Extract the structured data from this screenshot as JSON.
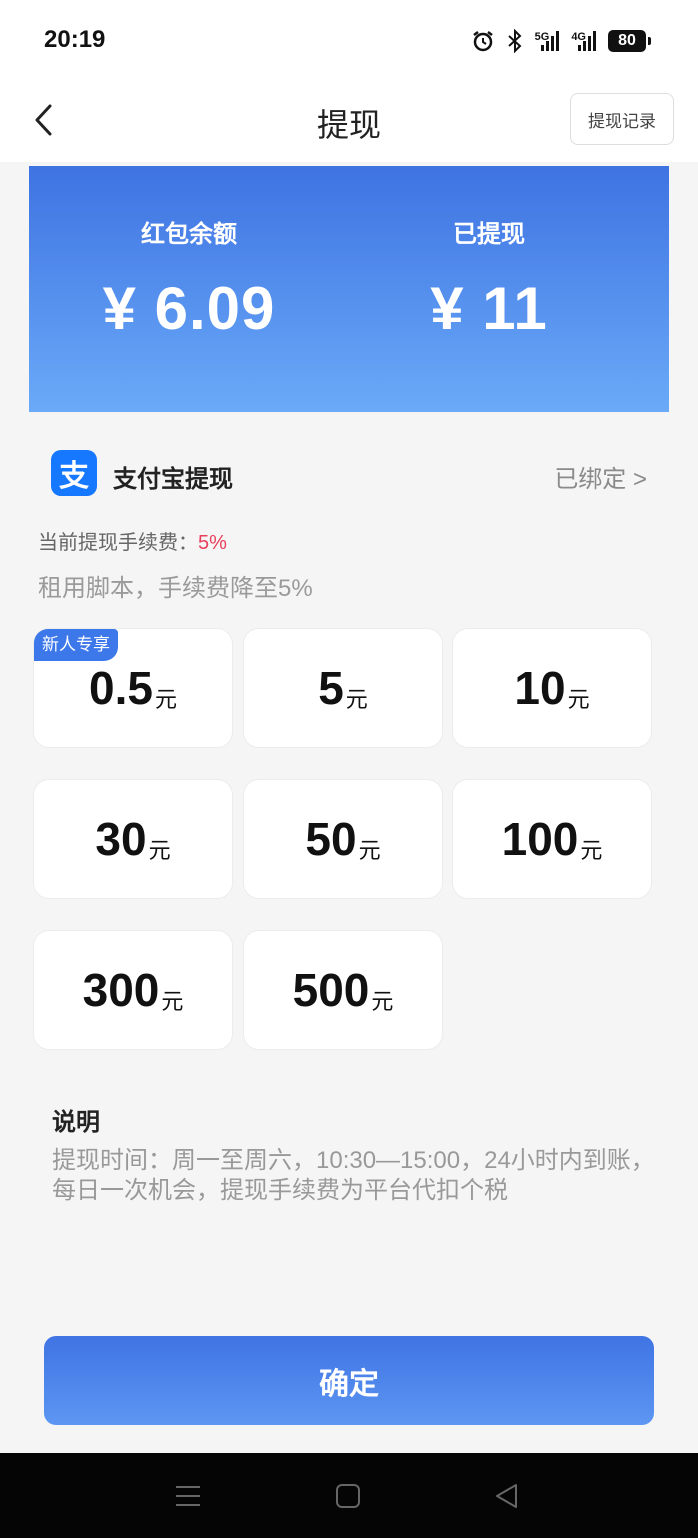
{
  "status_bar": {
    "time": "20:19",
    "network_5g": "5G",
    "network_4g": "4G",
    "battery": "80"
  },
  "nav": {
    "title": "提现",
    "record_button": "提现记录"
  },
  "balance": {
    "left_label": "红包余额",
    "left_value": "¥ 6.09",
    "right_label": "已提现",
    "right_value": "¥ 11"
  },
  "payment": {
    "icon_char": "支",
    "title": "支付宝提现",
    "status": "已绑定 >"
  },
  "fee": {
    "label": "当前提现手续费：",
    "rate": "5%",
    "tip": "租用脚本，手续费降至5%"
  },
  "amounts": [
    {
      "value": "0.5",
      "unit": "元",
      "badge": "新人专享"
    },
    {
      "value": "5",
      "unit": "元"
    },
    {
      "value": "10",
      "unit": "元"
    },
    {
      "value": "30",
      "unit": "元"
    },
    {
      "value": "50",
      "unit": "元"
    },
    {
      "value": "100",
      "unit": "元"
    },
    {
      "value": "300",
      "unit": "元"
    },
    {
      "value": "500",
      "unit": "元"
    }
  ],
  "description": {
    "title": "说明",
    "text": "提现时间：周一至周六，10:30—15:00，24小时内到账，每日一次机会，提现手续费为平台代扣个税"
  },
  "confirm_button": "确定",
  "colors": {
    "primary": "#3e73e2",
    "fee_rate": "#e8405b",
    "alipay": "#1677ff"
  }
}
